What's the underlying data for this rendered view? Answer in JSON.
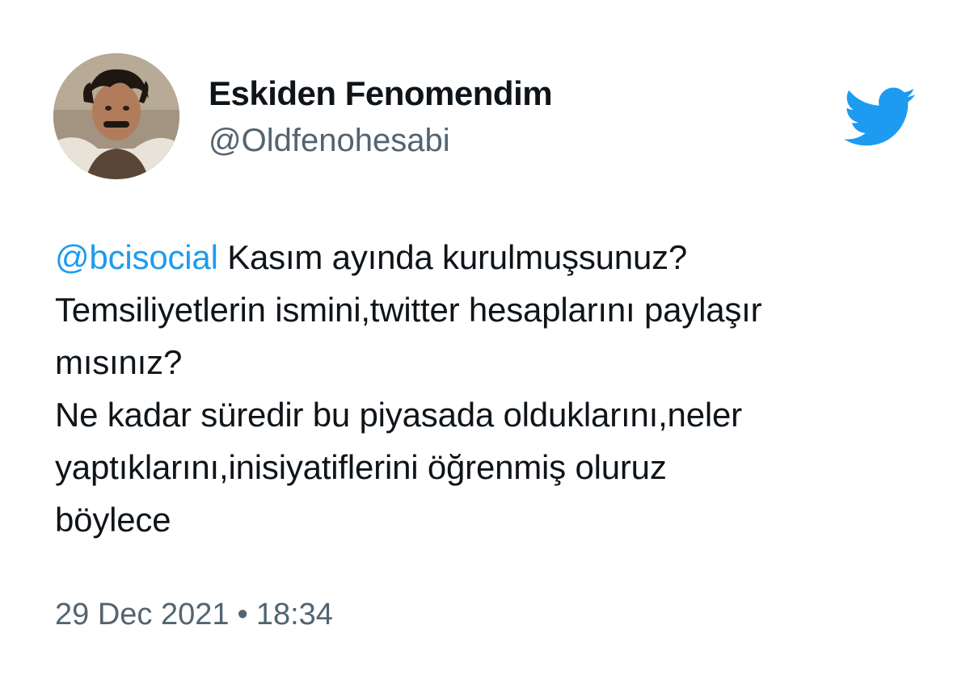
{
  "author": {
    "display_name": "Eskiden Fenomendim",
    "handle": "@Oldfenohesabi",
    "avatar_icon": "profile-photo"
  },
  "brand": {
    "icon": "twitter-bird-icon",
    "color": "#1d9bf0"
  },
  "tweet": {
    "mention": "@bcisocial",
    "line1_rest": " Kasım ayında kurulmuşsunuz?",
    "line2": "Temsiliyetlerin ismini,twitter hesaplarını paylaşır",
    "line3": "mısınız?",
    "line4": "Ne kadar süredir bu piyasada olduklarını,neler",
    "line5": "yaptıklarını,inisiyatiflerini öğrenmiş oluruz",
    "line6": "böylece"
  },
  "meta": {
    "date": "29 Dec 2021",
    "separator": "•",
    "time": "18:34"
  },
  "colors": {
    "text": "#0f1419",
    "secondary": "#536471",
    "link": "#1d9bf0"
  }
}
